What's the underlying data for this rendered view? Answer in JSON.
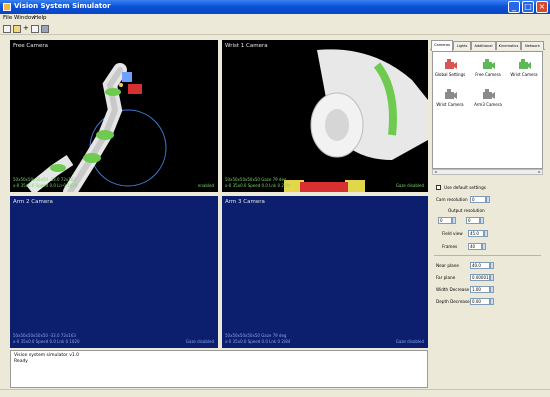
{
  "window": {
    "title": "Vision System Simulator"
  },
  "menu": [
    {
      "label": "File"
    },
    {
      "label": "Window"
    },
    {
      "label": "Help"
    }
  ],
  "toolbar_icons": [
    "new-icon",
    "open-icon",
    "add-icon",
    "save-icon",
    "settings-icon"
  ],
  "viewports": [
    {
      "title": "Free Camera",
      "status1": "50x50x50x50x50 -33.0 72x163",
      "status2": "x-0 35x0.0 Speed 0.0 Ln-0 1020",
      "badge": "enabled"
    },
    {
      "title": "Wrist 1 Camera",
      "status1": "50x50x50x50x50 Gaze 79 deg",
      "status2": "x-0 35x0.0 Speed 0.0 Lnk 0 2/84",
      "badge": "Gaze disabled"
    },
    {
      "title": "Arm 2 Camera",
      "status1": "50x50x50x50x50 -33.0 72x163",
      "status2": "x-0 35x0.0 Speed 0.0 Lnk 0 1020",
      "badge": "Gaze disabled"
    },
    {
      "title": "Arm 3 Camera",
      "status1": "50x50x50x50x50 Gaze 79 deg",
      "status2": "x-0 35x0.0 Speed 0.0 Lnk 0 2/84",
      "badge": "Gaze disabled"
    }
  ],
  "log": {
    "lines": [
      "Vision system simulator v1.0",
      "Ready"
    ]
  },
  "panel": {
    "tabs": [
      {
        "label": "Cameras",
        "active": true
      },
      {
        "label": "Lights"
      },
      {
        "label": "Additional"
      },
      {
        "label": "Kinematics"
      },
      {
        "label": "Network"
      }
    ],
    "cameras": [
      {
        "label": "Global Settings",
        "color": "#d8564f"
      },
      {
        "label": "Free Camera",
        "color": "#5db858"
      },
      {
        "label": "Wrist Camera",
        "color": "#5db858"
      },
      {
        "label": "Wrist Camera",
        "color": "#8a8a8a"
      },
      {
        "label": "Arm3 Camera",
        "color": "#8a8a8a"
      }
    ],
    "use_default_label": "Use default settings",
    "cam_resolution_label": "Cam resolution",
    "cam_resolution_value": "0",
    "output_resolution_label": "Output resolution",
    "out_w": "0",
    "out_h": "0",
    "field_view_label": "Field view",
    "field_view_value": "45.0",
    "frames_label": "Frames",
    "frames_value": "40",
    "near_label": "Near plane",
    "near_value": "40.0",
    "far_label": "Far plane",
    "far_value": "0.00001",
    "width_label": "Width Decrease",
    "width_value": "1.00",
    "depth_label": "Depth Decrease",
    "depth_value": "0.00"
  }
}
